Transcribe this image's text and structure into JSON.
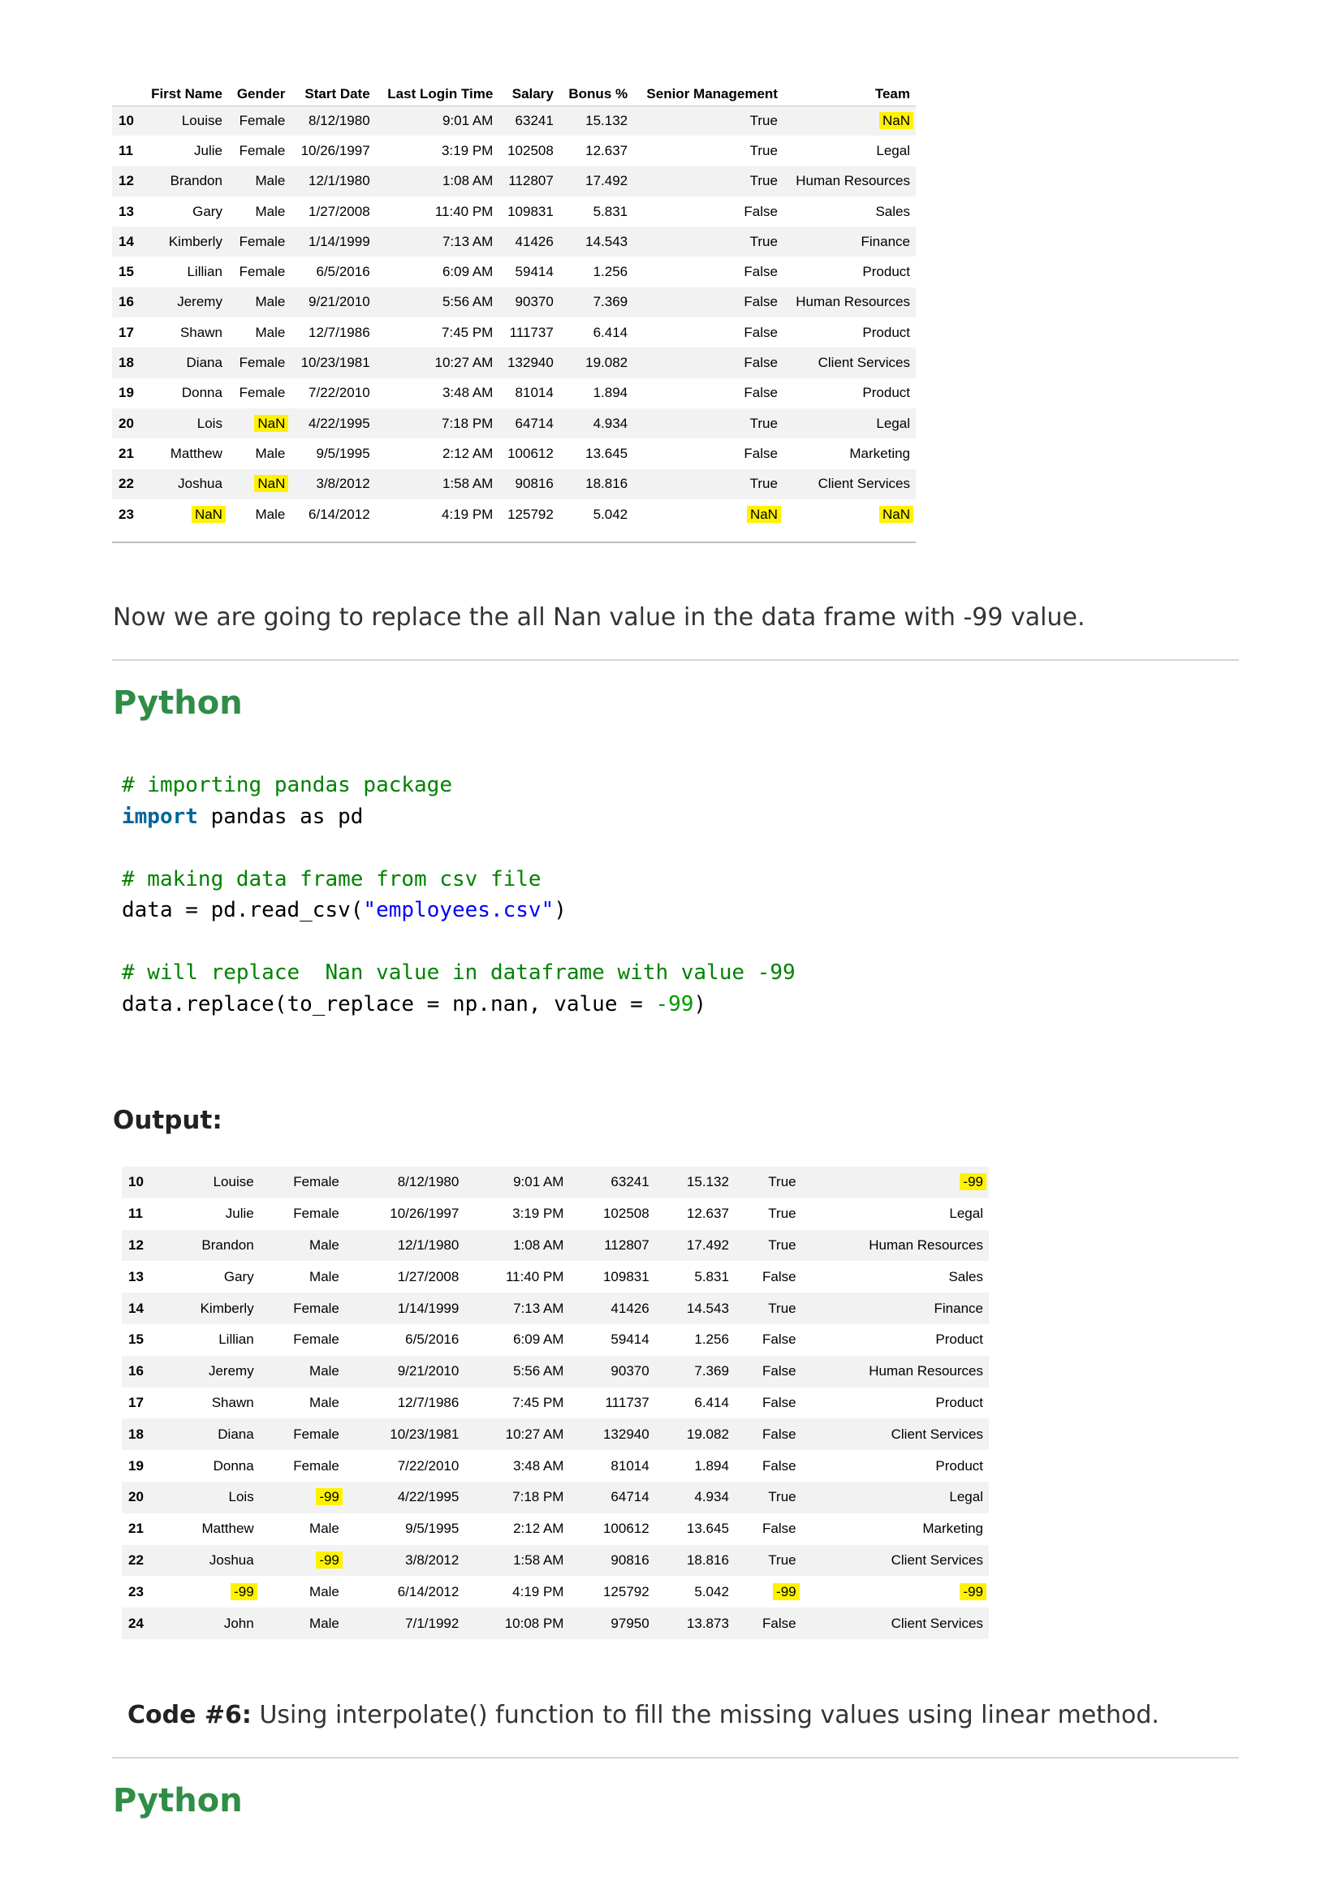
{
  "table1": {
    "columns": [
      "",
      "First Name",
      "Gender",
      "Start Date",
      "Last Login Time",
      "Salary",
      "Bonus %",
      "Senior Management",
      "Team"
    ],
    "rows": [
      [
        "10",
        "Louise",
        "Female",
        "8/12/1980",
        "9:01 AM",
        "63241",
        "15.132",
        "True",
        "NaN"
      ],
      [
        "11",
        "Julie",
        "Female",
        "10/26/1997",
        "3:19 PM",
        "102508",
        "12.637",
        "True",
        "Legal"
      ],
      [
        "12",
        "Brandon",
        "Male",
        "12/1/1980",
        "1:08 AM",
        "112807",
        "17.492",
        "True",
        "Human Resources"
      ],
      [
        "13",
        "Gary",
        "Male",
        "1/27/2008",
        "11:40 PM",
        "109831",
        "5.831",
        "False",
        "Sales"
      ],
      [
        "14",
        "Kimberly",
        "Female",
        "1/14/1999",
        "7:13 AM",
        "41426",
        "14.543",
        "True",
        "Finance"
      ],
      [
        "15",
        "Lillian",
        "Female",
        "6/5/2016",
        "6:09 AM",
        "59414",
        "1.256",
        "False",
        "Product"
      ],
      [
        "16",
        "Jeremy",
        "Male",
        "9/21/2010",
        "5:56 AM",
        "90370",
        "7.369",
        "False",
        "Human Resources"
      ],
      [
        "17",
        "Shawn",
        "Male",
        "12/7/1986",
        "7:45 PM",
        "111737",
        "6.414",
        "False",
        "Product"
      ],
      [
        "18",
        "Diana",
        "Female",
        "10/23/1981",
        "10:27 AM",
        "132940",
        "19.082",
        "False",
        "Client Services"
      ],
      [
        "19",
        "Donna",
        "Female",
        "7/22/2010",
        "3:48 AM",
        "81014",
        "1.894",
        "False",
        "Product"
      ],
      [
        "20",
        "Lois",
        "NaN",
        "4/22/1995",
        "7:18 PM",
        "64714",
        "4.934",
        "True",
        "Legal"
      ],
      [
        "21",
        "Matthew",
        "Male",
        "9/5/1995",
        "2:12 AM",
        "100612",
        "13.645",
        "False",
        "Marketing"
      ],
      [
        "22",
        "Joshua",
        "NaN",
        "3/8/2012",
        "1:58 AM",
        "90816",
        "18.816",
        "True",
        "Client Services"
      ],
      [
        "23",
        "NaN",
        "Male",
        "6/14/2012",
        "4:19 PM",
        "125792",
        "5.042",
        "NaN",
        "NaN"
      ]
    ]
  },
  "text1": "Now we are going to replace the all Nan value in the data frame with -99 value.",
  "lang1": "Python",
  "code": {
    "c1": "# importing pandas package",
    "kw_import": "import",
    "l2_rest": " pandas as pd",
    "c2": "# making data frame from csv file",
    "l5_a": "data = pd.read_csv(",
    "l5_str": "\"employees.csv\"",
    "l5_b": ")",
    "c3": "# will replace  Nan value in dataframe with value -99",
    "l8_a": "data.replace(to_replace = np.nan, value = ",
    "l8_num": "-99",
    "l8_b": ")"
  },
  "output_label": "Output:",
  "table2": {
    "rows": [
      [
        "10",
        "Louise",
        "Female",
        "8/12/1980",
        "9:01 AM",
        "63241",
        "15.132",
        "True",
        "-99"
      ],
      [
        "11",
        "Julie",
        "Female",
        "10/26/1997",
        "3:19 PM",
        "102508",
        "12.637",
        "True",
        "Legal"
      ],
      [
        "12",
        "Brandon",
        "Male",
        "12/1/1980",
        "1:08 AM",
        "112807",
        "17.492",
        "True",
        "Human Resources"
      ],
      [
        "13",
        "Gary",
        "Male",
        "1/27/2008",
        "11:40 PM",
        "109831",
        "5.831",
        "False",
        "Sales"
      ],
      [
        "14",
        "Kimberly",
        "Female",
        "1/14/1999",
        "7:13 AM",
        "41426",
        "14.543",
        "True",
        "Finance"
      ],
      [
        "15",
        "Lillian",
        "Female",
        "6/5/2016",
        "6:09 AM",
        "59414",
        "1.256",
        "False",
        "Product"
      ],
      [
        "16",
        "Jeremy",
        "Male",
        "9/21/2010",
        "5:56 AM",
        "90370",
        "7.369",
        "False",
        "Human Resources"
      ],
      [
        "17",
        "Shawn",
        "Male",
        "12/7/1986",
        "7:45 PM",
        "111737",
        "6.414",
        "False",
        "Product"
      ],
      [
        "18",
        "Diana",
        "Female",
        "10/23/1981",
        "10:27 AM",
        "132940",
        "19.082",
        "False",
        "Client Services"
      ],
      [
        "19",
        "Donna",
        "Female",
        "7/22/2010",
        "3:48 AM",
        "81014",
        "1.894",
        "False",
        "Product"
      ],
      [
        "20",
        "Lois",
        "-99",
        "4/22/1995",
        "7:18 PM",
        "64714",
        "4.934",
        "True",
        "Legal"
      ],
      [
        "21",
        "Matthew",
        "Male",
        "9/5/1995",
        "2:12 AM",
        "100612",
        "13.645",
        "False",
        "Marketing"
      ],
      [
        "22",
        "Joshua",
        "-99",
        "3/8/2012",
        "1:58 AM",
        "90816",
        "18.816",
        "True",
        "Client Services"
      ],
      [
        "23",
        "-99",
        "Male",
        "6/14/2012",
        "4:19 PM",
        "125792",
        "5.042",
        "-99",
        "-99"
      ],
      [
        "24",
        "John",
        "Male",
        "7/1/1992",
        "10:08 PM",
        "97950",
        "13.873",
        "False",
        "Client Services"
      ]
    ]
  },
  "code6_label": "Code #6:",
  "code6_text": " Using interpolate() function to fill the missing values using linear method.",
  "lang2": "Python",
  "highlight": "#fff200",
  "accent_green": "#2f8d46"
}
